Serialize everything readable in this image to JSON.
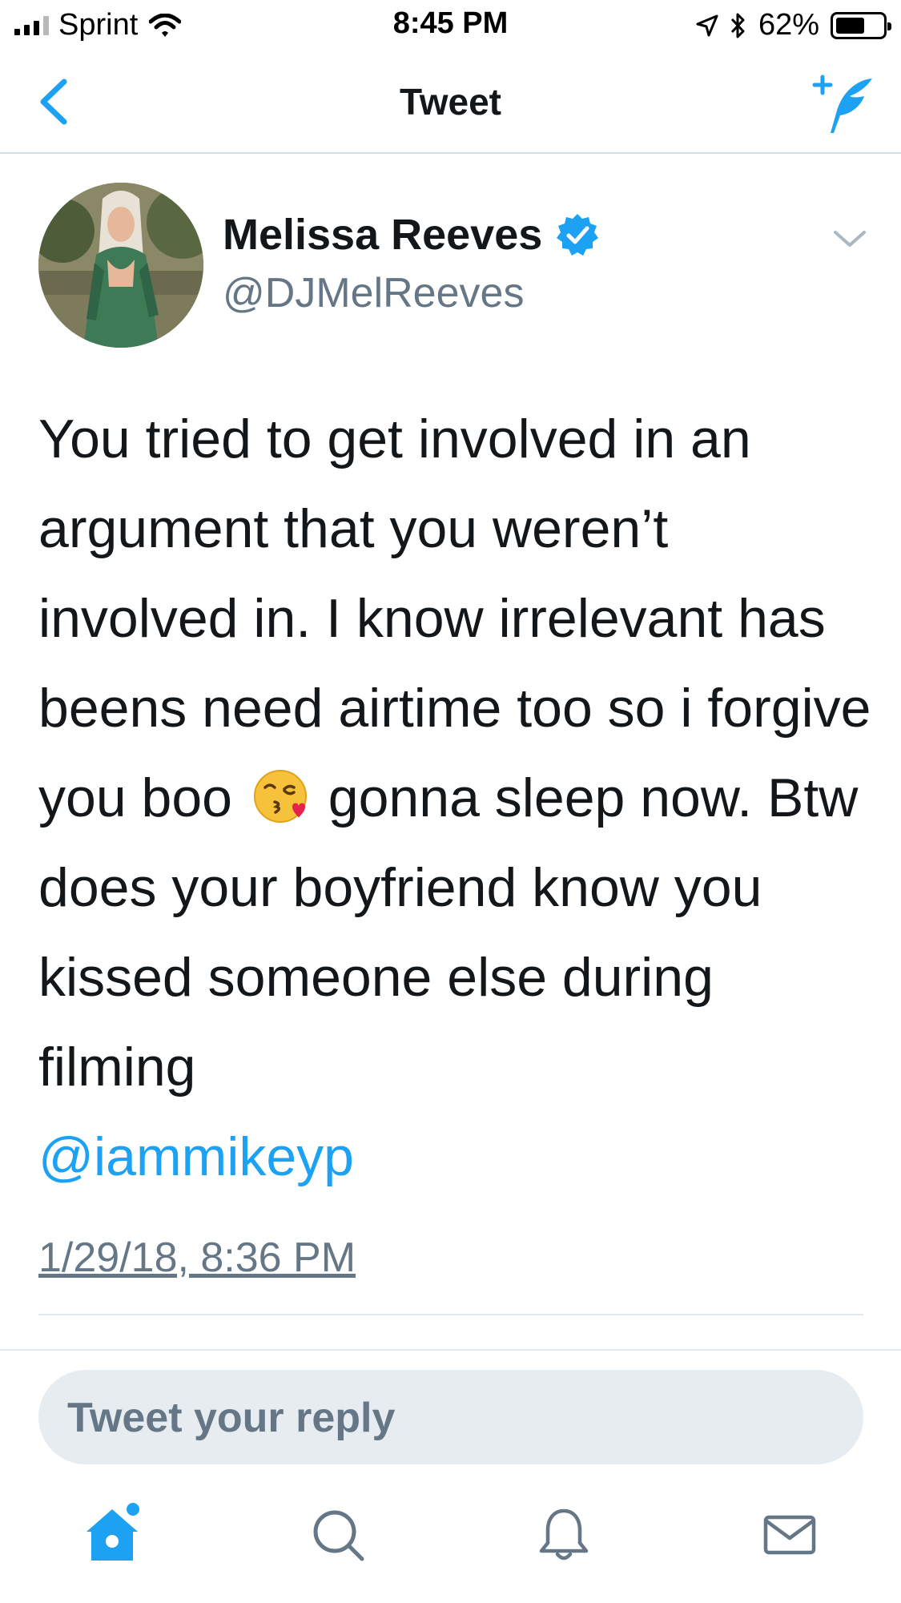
{
  "status_bar": {
    "carrier": "Sprint",
    "time": "8:45 PM",
    "battery": "62%",
    "battery_level": 0.62
  },
  "nav": {
    "title": "Tweet"
  },
  "tweet": {
    "display_name": "Melissa Reeves",
    "handle": "@DJMelReeves",
    "verified": true,
    "text_before_emoji": "You tried to get involved in an argument that you weren’t involved in. I know irrelevant has beens need airtime too so i forgive  you boo",
    "emoji": "face-blowing-a-kiss",
    "text_after_emoji": "gonna sleep now. Btw does your boyfriend know you kissed someone else during filming",
    "mention": "@iammikeyp",
    "timestamp": "1/29/18, 8:36 PM"
  },
  "reply": {
    "placeholder": "Tweet your reply"
  },
  "tabbar": {
    "items": [
      "home-icon",
      "search-icon",
      "bell-icon",
      "mail-icon"
    ]
  },
  "colors": {
    "accent": "#1da1f2",
    "secondary_text": "#657786",
    "reply_bg": "#e6ecf0"
  }
}
